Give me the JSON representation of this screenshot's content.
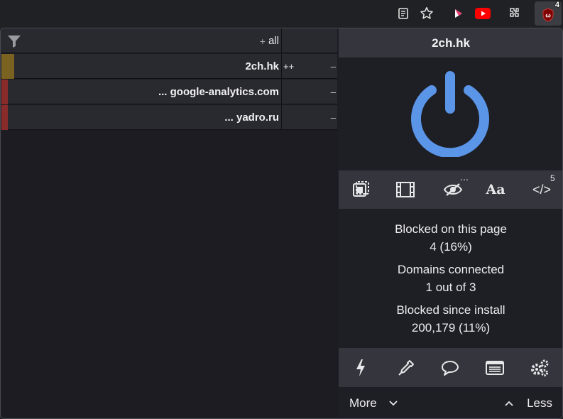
{
  "toolbar": {
    "icons": [
      "reader-mode-icon",
      "bookmark-star-icon",
      "play-extension-icon",
      "youtube-extension-icon",
      "extensions-puzzle-icon",
      "ublock-origin-icon"
    ],
    "ublock_badge": "4",
    "colors": {
      "youtube_red": "#ff0000",
      "ublock_red": "#800000"
    }
  },
  "firewall": {
    "header": {
      "plus": "+",
      "label": "all"
    },
    "rows": [
      {
        "domain": "2ch.hk",
        "count": "++",
        "action": "–",
        "color": "#7a6320"
      },
      {
        "domain": "... google-analytics.com",
        "count": "",
        "action": "–",
        "color": "#8a2b2b"
      },
      {
        "domain": "... yadro.ru",
        "count": "",
        "action": "–",
        "color": "#8a2b2b"
      }
    ]
  },
  "main": {
    "hostname": "2ch.hk",
    "power_color": "#5a95e8",
    "tools": {
      "element_picker": "remove-popups-icon",
      "media": "large-media-icon",
      "cosmetic": "cosmetic-filtering-icon",
      "fonts": "Aa",
      "scripts": "</>",
      "scripts_count": "5",
      "cosmetic_dots": "⋯"
    },
    "stats": [
      {
        "label": "Blocked on this page",
        "value": "4 (16%)"
      },
      {
        "label": "Domains connected",
        "value": "1 out of 3"
      },
      {
        "label": "Blocked since install",
        "value": "200,179 (11%)"
      }
    ],
    "bottom_tools": [
      "zapper-icon",
      "picker-eyedropper-icon",
      "report-speech-icon",
      "logger-list-icon",
      "dashboard-gears-icon"
    ],
    "more_label": "More",
    "less_label": "Less"
  }
}
